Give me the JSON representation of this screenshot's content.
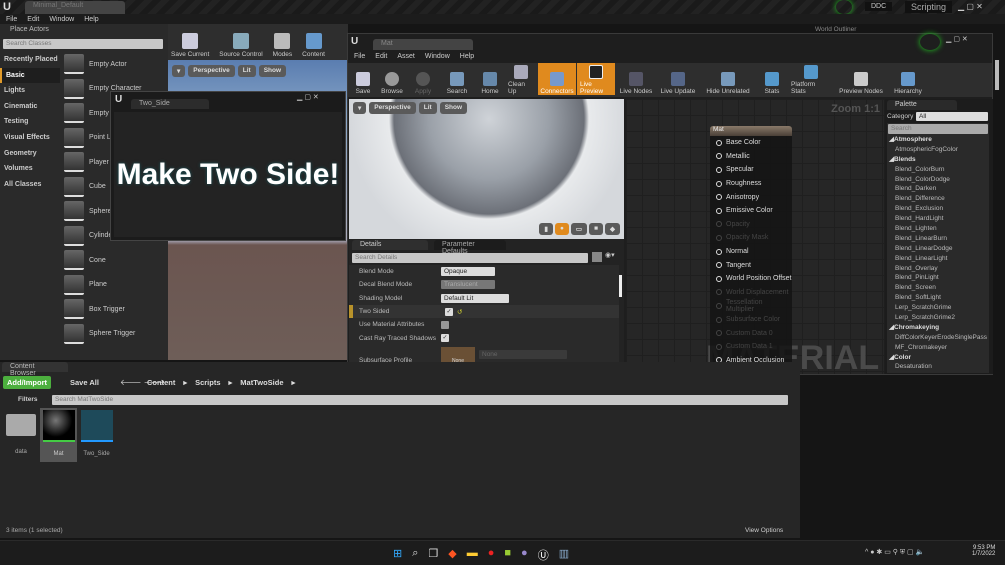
{
  "main_window": {
    "title": "Minimal_Default",
    "menu": [
      "File",
      "Edit",
      "Window",
      "Help"
    ],
    "ddc": "DDC",
    "scripting": "Scripting",
    "world_outliner": "World Outliner"
  },
  "place_actors": {
    "tab": "Place Actors",
    "search_placeholder": "Search Classes",
    "categories": [
      "Recently Placed",
      "Basic",
      "Lights",
      "Cinematic",
      "Testing",
      "Visual Effects",
      "Geometry",
      "Volumes",
      "All Classes"
    ],
    "selected_category": "Basic",
    "items": [
      "Empty Actor",
      "Empty Character",
      "Empty Pawn",
      "Point Light",
      "Player Start",
      "Cube",
      "Sphere",
      "Cylinder",
      "Cone",
      "Plane",
      "Box Trigger",
      "Sphere Trigger"
    ]
  },
  "level_toolbar": [
    "Save Current",
    "Source Control",
    "Modes",
    "Content"
  ],
  "level_viewport": {
    "view": "Perspective",
    "lit": "Lit",
    "show": "Show"
  },
  "two_side_window": {
    "tab": "Two_Side",
    "text": "Make Two Side!"
  },
  "material_editor": {
    "tab": "Mat",
    "menu": [
      "File",
      "Edit",
      "Asset",
      "Window",
      "Help"
    ],
    "toolbar": [
      "Save",
      "Browse",
      "Apply",
      "Search",
      "Home",
      "Clean Up",
      "Connectors",
      "Live Preview",
      "Live Nodes",
      "Live Update",
      "Hide Unrelated",
      "Stats",
      "Platform Stats",
      "Preview Nodes",
      "Hierarchy"
    ],
    "viewport": {
      "view": "Perspective",
      "lit": "Lit",
      "show": "Show"
    },
    "details": {
      "tabs": [
        "Details",
        "Parameter Defaults"
      ],
      "search_placeholder": "Search Details",
      "rows": [
        {
          "label": "Blend Mode",
          "value": "Opaque"
        },
        {
          "label": "Decal Blend Mode",
          "value": "Translucent"
        },
        {
          "label": "Shading Model",
          "value": "Default Lit"
        },
        {
          "label": "Two Sided",
          "checked": true
        },
        {
          "label": "Use Material Attributes",
          "checked": false
        },
        {
          "label": "Cast Ray Traced Shadows",
          "checked": true
        },
        {
          "label": "Subsurface Profile",
          "value": "None",
          "thumb": "None"
        }
      ]
    },
    "graph": {
      "zoom": "Zoom 1:1",
      "node_title": "Mat",
      "watermark": "MATERIAL",
      "pins": [
        {
          "n": "Base Color",
          "on": true
        },
        {
          "n": "Metallic",
          "on": true
        },
        {
          "n": "Specular",
          "on": true
        },
        {
          "n": "Roughness",
          "on": true
        },
        {
          "n": "Anisotropy",
          "on": true
        },
        {
          "n": "Emissive Color",
          "on": true
        },
        {
          "n": "Opacity",
          "on": false
        },
        {
          "n": "Opacity Mask",
          "on": false
        },
        {
          "n": "Normal",
          "on": true
        },
        {
          "n": "Tangent",
          "on": true
        },
        {
          "n": "World Position Offset",
          "on": true
        },
        {
          "n": "World Displacement",
          "on": false
        },
        {
          "n": "Tessellation Multiplier",
          "on": false
        },
        {
          "n": "Subsurface Color",
          "on": false
        },
        {
          "n": "Custom Data 0",
          "on": false
        },
        {
          "n": "Custom Data 1",
          "on": false
        },
        {
          "n": "Ambient Occlusion",
          "on": true
        }
      ]
    },
    "palette": {
      "tab": "Palette",
      "category_label": "Category",
      "category_value": "All",
      "search_placeholder": "Search",
      "entries": [
        {
          "t": "Atmosphere",
          "h": true
        },
        {
          "t": "AtmosphericFogColor"
        },
        {
          "t": "Blends",
          "h": true
        },
        {
          "t": "Blend_ColorBurn"
        },
        {
          "t": "Blend_ColorDodge"
        },
        {
          "t": "Blend_Darken"
        },
        {
          "t": "Blend_Difference"
        },
        {
          "t": "Blend_Exclusion"
        },
        {
          "t": "Blend_HardLight"
        },
        {
          "t": "Blend_Lighten"
        },
        {
          "t": "Blend_LinearBurn"
        },
        {
          "t": "Blend_LinearDodge"
        },
        {
          "t": "Blend_LinearLight"
        },
        {
          "t": "Blend_Overlay"
        },
        {
          "t": "Blend_PinLight"
        },
        {
          "t": "Blend_Screen"
        },
        {
          "t": "Blend_SoftLight"
        },
        {
          "t": "Lerp_ScratchGrime"
        },
        {
          "t": "Lerp_ScratchGrime2"
        },
        {
          "t": "Chromakeying",
          "h": true
        },
        {
          "t": "DiffColorKeyerErodeSinglePass"
        },
        {
          "t": "MF_Chromakeyer"
        },
        {
          "t": "Color",
          "h": true
        },
        {
          "t": "Desaturation"
        }
      ]
    }
  },
  "content_browser": {
    "tab": "Content Browser",
    "add_import": "Add/Import",
    "save_all": "Save All",
    "path": [
      "Content",
      "Scripts",
      "MatTwoSide"
    ],
    "filters": "Filters",
    "search_placeholder": "Search MatTwoSide",
    "assets": [
      "data",
      "Mat",
      "Two_Side"
    ],
    "status": "3 items (1 selected)",
    "view_options": "View Options"
  },
  "taskbar": {
    "time": "9:53 PM",
    "date": "1/7/2022"
  },
  "colors": {
    "accent": "#e08a1e",
    "add_import": "#4caf3e"
  }
}
